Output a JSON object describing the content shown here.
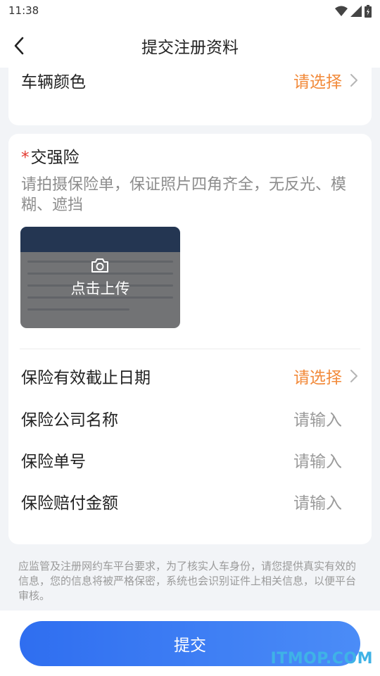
{
  "status_bar": {
    "time": "11:38",
    "icons": [
      "wifi-icon",
      "signal-icon",
      "battery-icon"
    ]
  },
  "nav": {
    "title": "提交注册资料",
    "back_icon": "chevron-left-icon"
  },
  "vehicle_color": {
    "label": "车辆颜色",
    "value": "请选择"
  },
  "insurance": {
    "required_mark": "*",
    "title": "交强险",
    "hint": "请拍摄保险单，保证照片四角齐全，无反光、模糊、遮挡",
    "upload": {
      "label": "点击上传",
      "icon": "camera-icon"
    },
    "fields": {
      "expiry": {
        "label": "保险有效截止日期",
        "value": "请选择"
      },
      "company": {
        "label": "保险公司名称",
        "placeholder": "请输入"
      },
      "policy_no": {
        "label": "保险单号",
        "placeholder": "请输入"
      },
      "amount": {
        "label": "保险赔付金额",
        "placeholder": "请输入"
      }
    }
  },
  "notice": "应监管及注册网约车平台要求，为了核实人车身份，请您提供真实有效的信息，您的信息将被严格保密，系统也会识别证件上相关信息，以便平台审核。",
  "submit": {
    "label": "提交"
  },
  "watermark": "ITMOP.COM",
  "colors": {
    "accent_orange": "#f28a3a",
    "primary_blue": "#2f6ef0",
    "required_red": "#e3392f",
    "background": "#f2f4f7"
  }
}
